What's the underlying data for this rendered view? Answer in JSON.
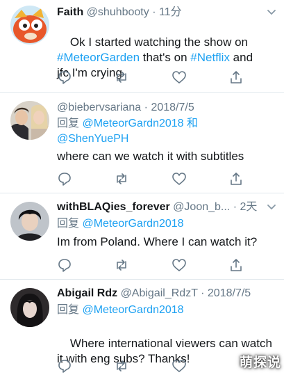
{
  "tweets": [
    {
      "display_name": "Faith",
      "handle": "@shuhbooty",
      "separator": "·",
      "time": "11分",
      "body_parts": [
        {
          "text": "Ok I started watching the show on\n",
          "link": false
        },
        {
          "text": "#MeteorGarden",
          "link": true
        },
        {
          "text": " that's on ",
          "link": false
        },
        {
          "text": "#Netflix",
          "link": true
        },
        {
          "text": " and\njfc I'm crying",
          "link": false
        }
      ]
    },
    {
      "display_name": "",
      "handle": "@biebervsariana",
      "separator": "·",
      "time": "2018/7/5",
      "reply_prefix": "回复 ",
      "reply_mention": "@MeteorGardn2018",
      "reply_join": " 和",
      "reply_mention_2": "@ShenYuePH",
      "body_parts": [
        {
          "text": "where can we watch it with subtitles",
          "link": false
        }
      ]
    },
    {
      "display_name": "withBLAQies_forever",
      "handle": "@Joon_b...",
      "separator": "·",
      "time": "2天",
      "reply_prefix": "回复 ",
      "reply_mention": "@MeteorGardn2018",
      "body_parts": [
        {
          "text": "Im from Poland. Where I can watch it?",
          "link": false
        }
      ]
    },
    {
      "display_name": "Abigail Rdz",
      "handle": "@Abigail_RdzT",
      "separator": "·",
      "time": "2018/7/5",
      "reply_prefix": "回复 ",
      "reply_mention": "@MeteorGardn2018",
      "body_parts": [
        {
          "text": "Where international viewers can watch\nit with eng subs? Thanks!",
          "link": false
        }
      ]
    }
  ],
  "action_icons": [
    "reply-icon",
    "retweet-icon",
    "like-icon",
    "share-icon"
  ],
  "watermark": "萌探说",
  "colors": {
    "link": "#1da1f2",
    "text": "#14171a",
    "muted": "#657786",
    "divider": "#e1e8ed"
  }
}
